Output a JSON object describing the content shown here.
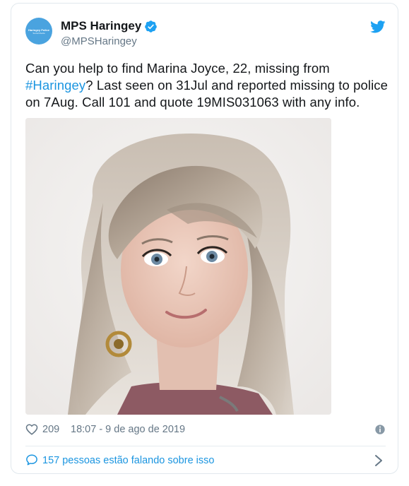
{
  "account": {
    "display_name": "MPS Haringey",
    "handle": "@MPSHaringey",
    "avatar_text_line1": "Haringey Police",
    "avatar_text_line2": "Social Media"
  },
  "tweet": {
    "text_part1": "Can you help to find Marina Joyce, 22, missing from ",
    "hashtag": "#Haringey",
    "text_part2": "? Last seen on 31Jul and reported missing to police on 7Aug. Call 101 and quote 19MIS031063 with any info."
  },
  "meta": {
    "likes": "209",
    "timestamp": "18:07 - 9 de ago de 2019"
  },
  "footer": {
    "conversation_label": "157 pessoas estão falando sobre isso"
  },
  "icons": {
    "verified": "verified-badge-icon",
    "brand": "twitter-bird-icon",
    "like": "heart-icon",
    "info": "info-icon",
    "reply": "speech-bubble-icon",
    "more": "chevron-right-icon"
  },
  "colors": {
    "accent": "#1b95e0",
    "verified": "#1da1f2",
    "secondary_text": "#657786",
    "border": "#e1e8ed"
  }
}
